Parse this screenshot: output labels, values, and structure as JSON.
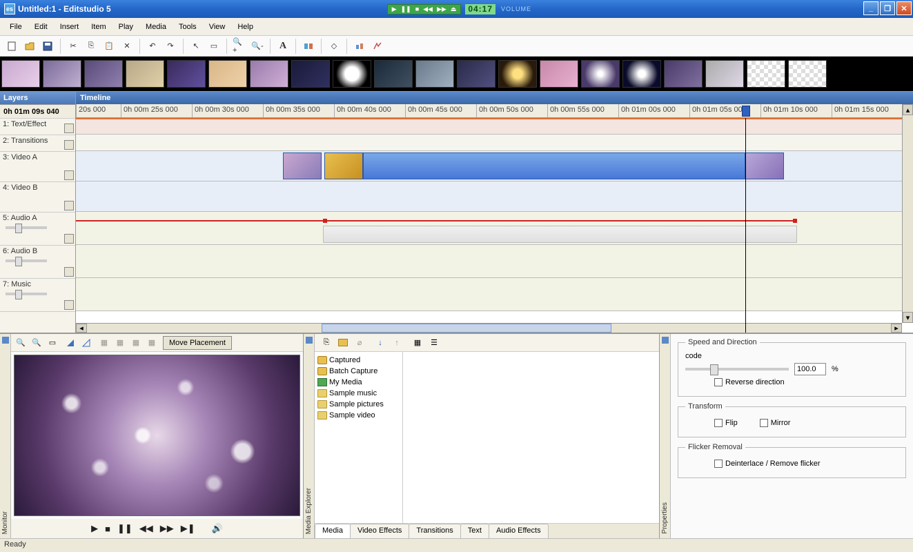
{
  "title": "Untitled:1 - Editstudio 5",
  "media_ctrl_time": "04:17",
  "volume_label": "VOLUME",
  "menu": [
    "File",
    "Edit",
    "Insert",
    "Item",
    "Play",
    "Media",
    "Tools",
    "View",
    "Help"
  ],
  "layers": {
    "header": "Layers",
    "time": "0h 01m 09s 040",
    "items": [
      {
        "label": "1: Text/Effect"
      },
      {
        "label": "2: Transitions"
      },
      {
        "label": "3: Video A"
      },
      {
        "label": "4: Video B"
      },
      {
        "label": "5: Audio A"
      },
      {
        "label": "6: Audio B"
      },
      {
        "label": "7: Music"
      }
    ]
  },
  "timeline": {
    "header": "Timeline",
    "ticks": [
      "20s 000",
      "0h 00m 25s 000",
      "0h 00m 30s 000",
      "0h 00m 35s 000",
      "0h 00m 40s 000",
      "0h 00m 45s 000",
      "0h 00m 50s 000",
      "0h 00m 55s 000",
      "0h 01m 00s 000",
      "0h 01m 05s 000",
      "0h 01m 10s 000",
      "0h 01m 15s 000"
    ]
  },
  "monitor": {
    "move_placement": "Move Placement",
    "vtab": "Monitor"
  },
  "media_explorer": {
    "vtab": "Media Explorer",
    "tree": [
      {
        "icon": "c",
        "label": "Captured"
      },
      {
        "icon": "b",
        "label": "Batch Capture"
      },
      {
        "icon": "m",
        "label": "My Media"
      },
      {
        "icon": "f",
        "label": "Sample music"
      },
      {
        "icon": "f",
        "label": "Sample pictures"
      },
      {
        "icon": "f",
        "label": "Sample video"
      }
    ],
    "tabs": [
      "Media",
      "Video Effects",
      "Transitions",
      "Text",
      "Audio Effects"
    ]
  },
  "properties": {
    "vtab": "Properties",
    "speed_dir": "Speed and Direction",
    "speed_value": "100.0",
    "percent": "%",
    "reverse": "Reverse direction",
    "transform": "Transform",
    "flip": "Flip",
    "mirror": "Mirror",
    "flicker": "Flicker Removal",
    "deint": "Deinterlace / Remove flicker"
  },
  "status": "Ready"
}
